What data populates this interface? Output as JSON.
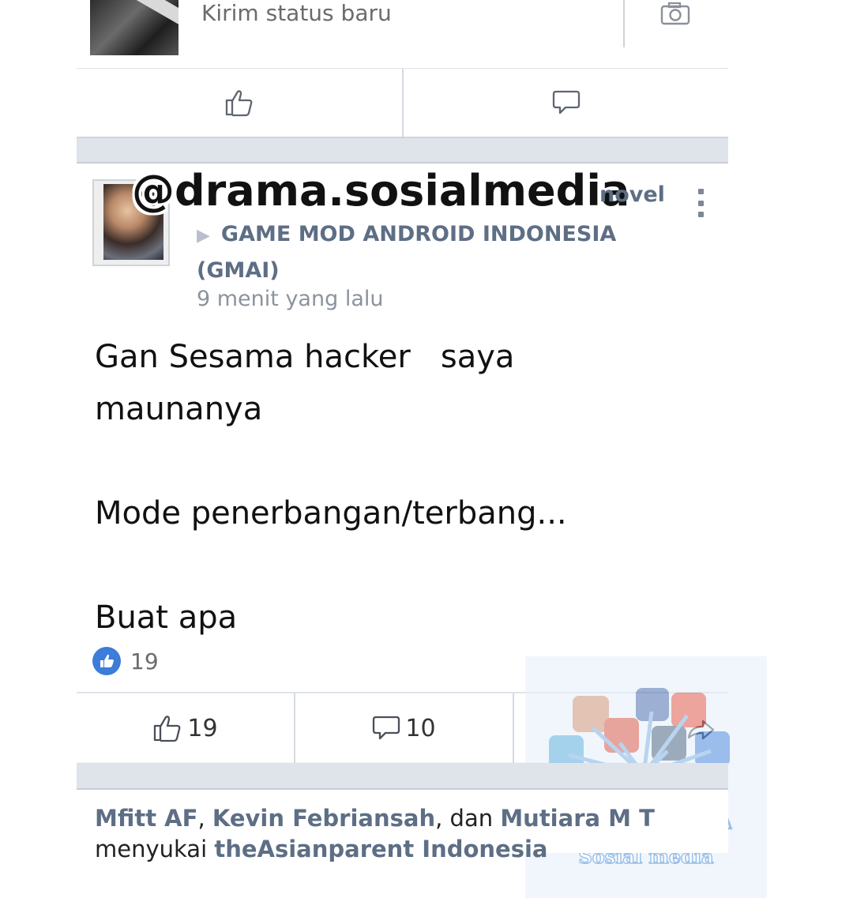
{
  "composer": {
    "placeholder": "Kirim status baru"
  },
  "post": {
    "watermark": "@drama.sosialmedia",
    "author_tail": "novel",
    "group_name": "GAME MOD ANDROID INDONESIA (GMAI)",
    "time": "9 menit yang lalu",
    "body_lines": [
      "Gan Sesama hacker   saya",
      "maunanya",
      "",
      "Mode penerbangan/terbang...",
      "",
      "Buat apa"
    ],
    "reaction_count": "19",
    "like_count": "19",
    "comment_count": "10"
  },
  "next": {
    "name1": "Mfitt AF",
    "sep1": ", ",
    "name2": "Kevin Febriansah",
    "sep2": ", dan ",
    "name3": "Mutiara M T",
    "verb": "menyukai ",
    "page": "theAsianparent Indonesia"
  },
  "stamp": {
    "title": "DRAMA",
    "subtitle": "Sosial media"
  },
  "colors": {
    "link": "#5d6e85",
    "like_badge": "#3b7dd8",
    "divider": "#dfe3ea"
  }
}
